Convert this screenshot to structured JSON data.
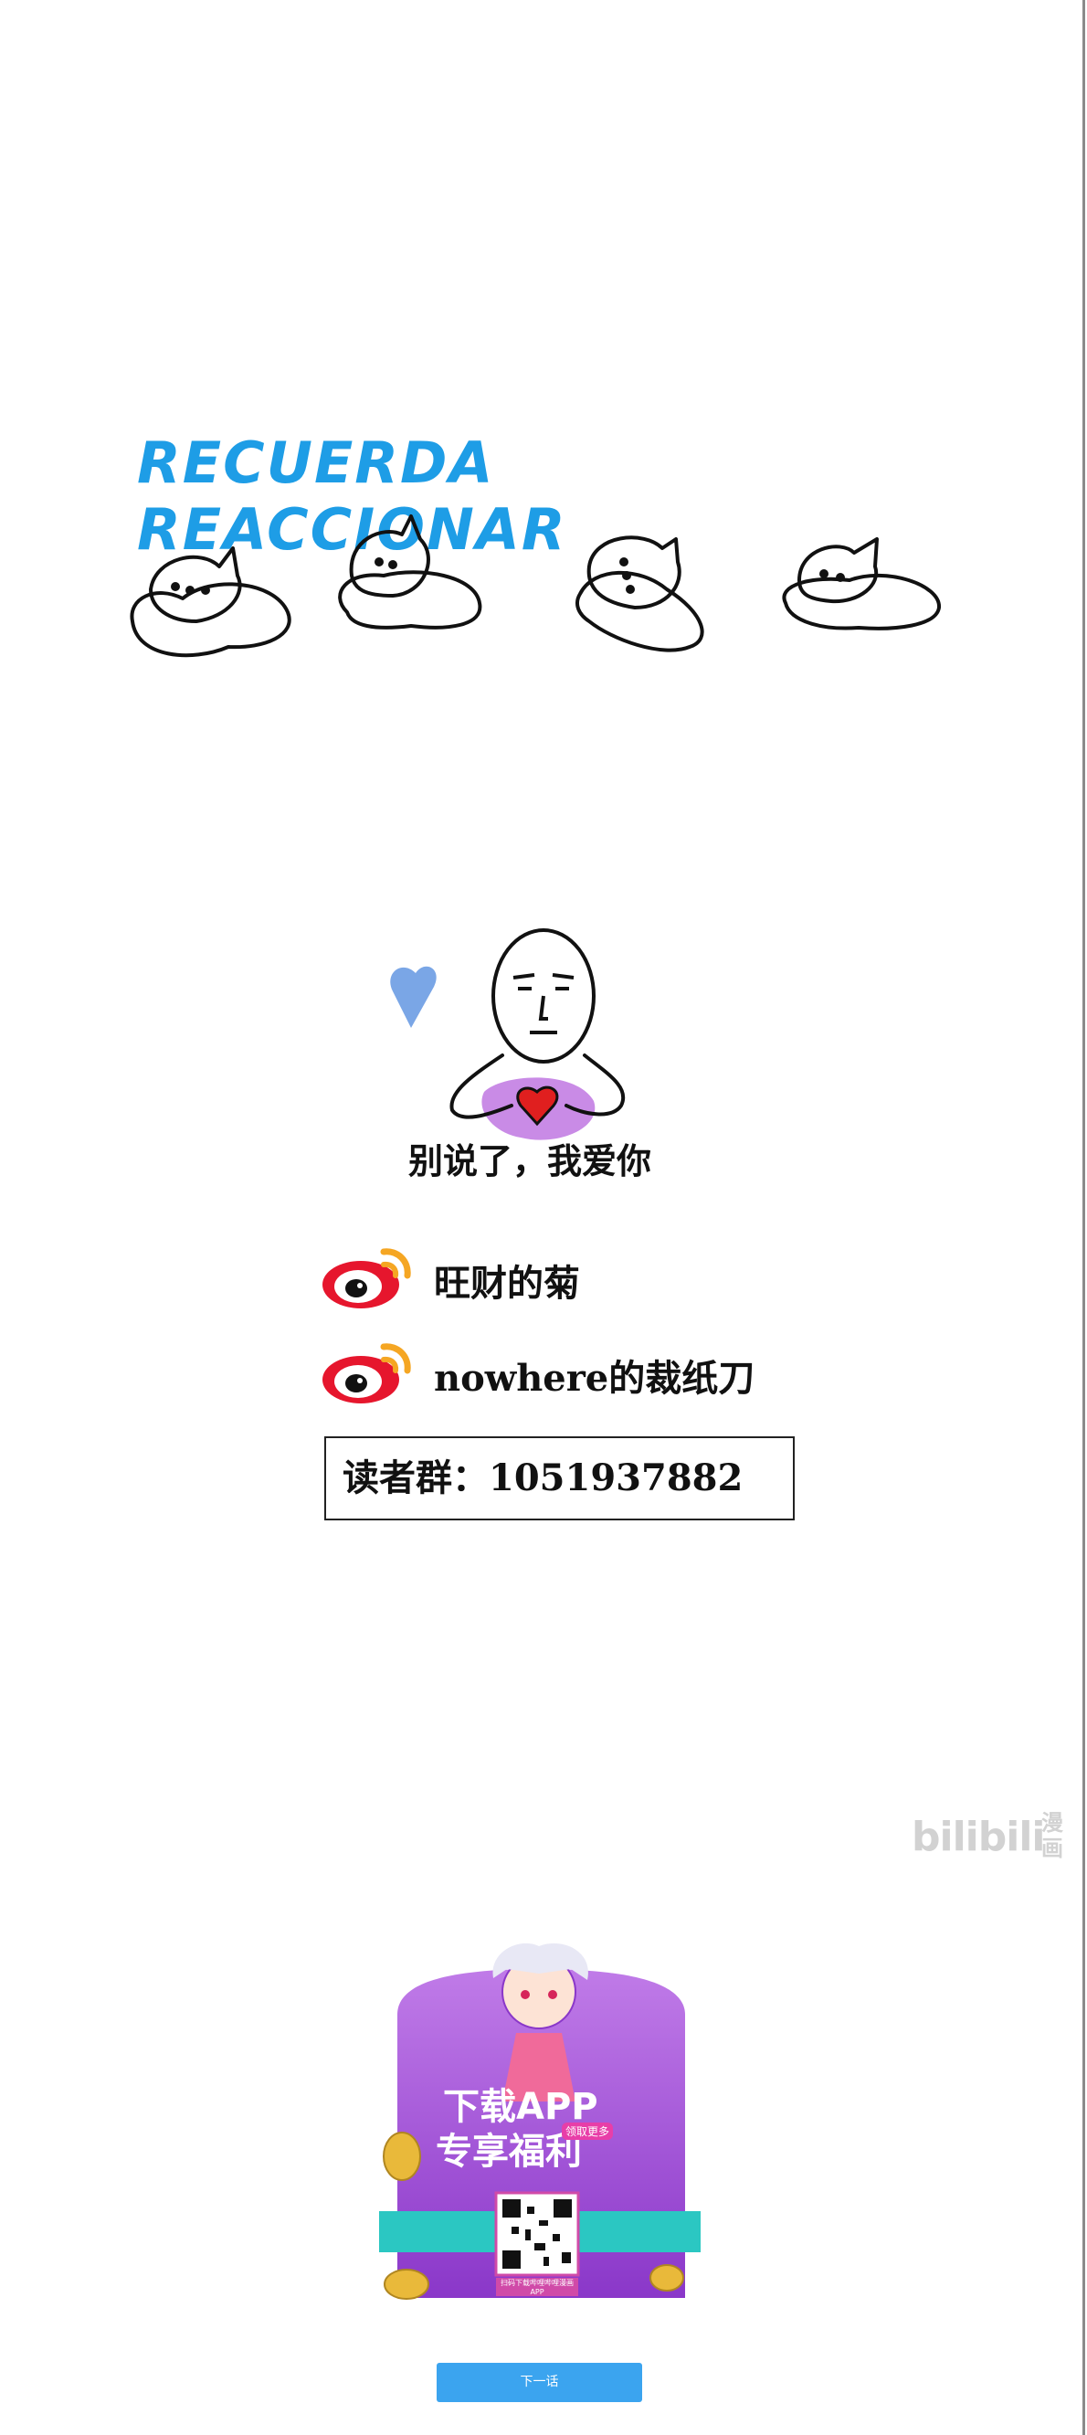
{
  "reminder_title": "RECUERDA REACCIONAR",
  "meme": {
    "caption": "别说了，我爱你"
  },
  "socials": [
    {
      "platform_icon": "weibo-icon",
      "handle": "旺财的菊"
    },
    {
      "platform_icon": "weibo-icon",
      "handle": "nowhere的裁纸刀"
    }
  ],
  "reader_group": "读者群：1051937882",
  "watermark": {
    "brand": "bilibili",
    "sub": "漫画"
  },
  "ad": {
    "headline_line1": "下载APP",
    "headline_line2": "专享福利",
    "badge": "领取更多",
    "qr_caption": "扫码下载哔哩哔哩漫画APP"
  },
  "next_button": "下一话",
  "colors": {
    "title_blue": "#1e9de6",
    "button_blue": "#3ba4ef",
    "weibo_red": "#e6162d",
    "weibo_orange": "#f5a623",
    "ad_purple": "#a64bd6"
  }
}
